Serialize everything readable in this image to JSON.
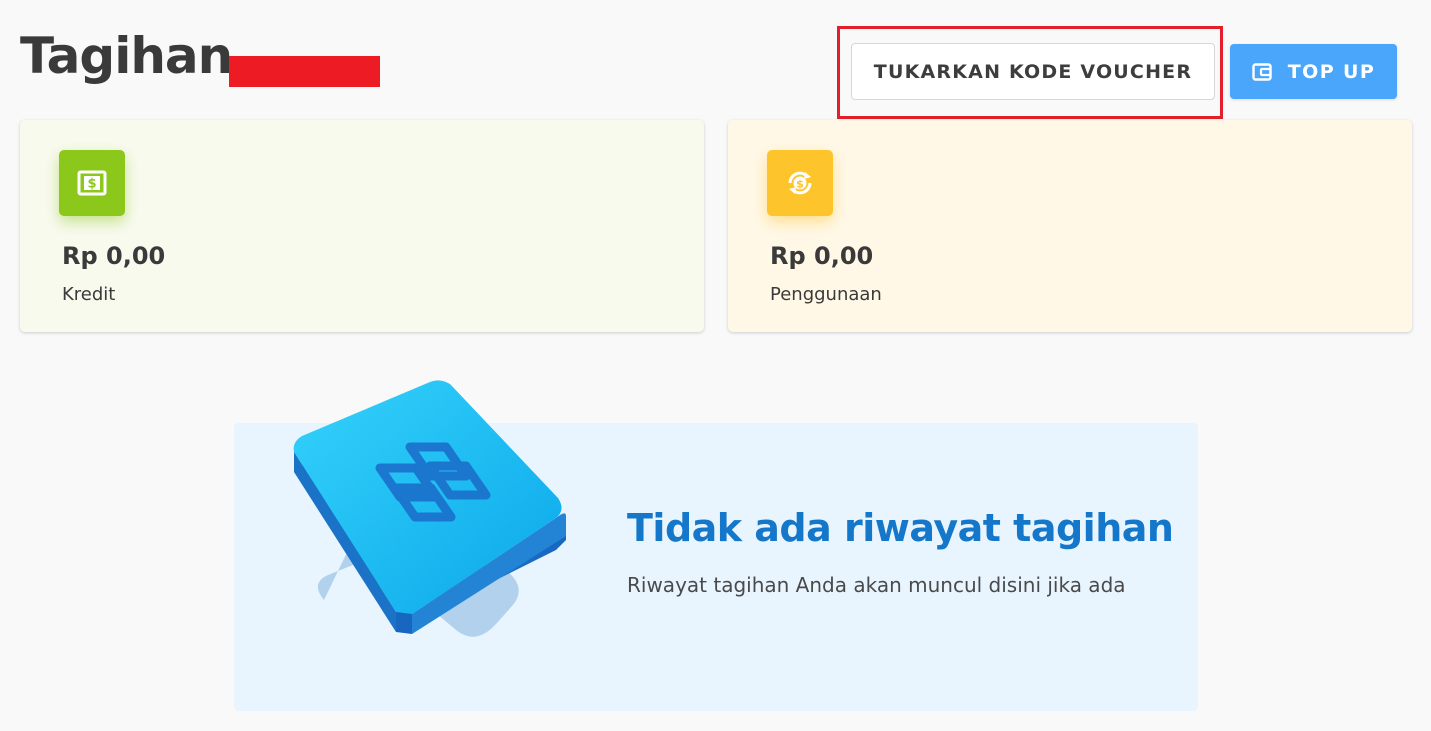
{
  "header": {
    "title": "Tagihan",
    "voucher_button_label": "TUKARKAN KODE VOUCHER",
    "topup_button_label": "TOP UP",
    "topup_icon": "wallet-icon"
  },
  "cards": {
    "credit": {
      "amount": "Rp 0,00",
      "label": "Kredit",
      "icon": "money-bill-icon",
      "color": "#8cc71c"
    },
    "usage": {
      "amount": "Rp 0,00",
      "label": "Penggunaan",
      "icon": "coin-cycle-icon",
      "color": "#fec42b"
    }
  },
  "empty_state": {
    "title": "Tidak ada riwayat tagihan",
    "subtitle": "Riwayat tagihan Anda akan muncul disini jika ada",
    "illustration": "cube-logo-illustration"
  },
  "colors": {
    "primary": "#4aa6fa",
    "title_blue": "#1577c9",
    "highlight": "#e41e2b",
    "redaction": "#ed1c24"
  }
}
